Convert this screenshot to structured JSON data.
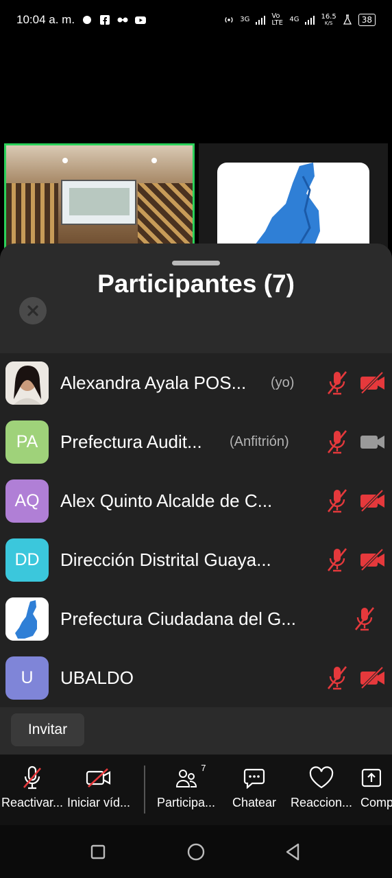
{
  "status_bar": {
    "time": "10:04 a. m.",
    "net_3g": "3G",
    "volte": "Vo LTE",
    "net_4g": "4G",
    "speed": "16.5",
    "speed_unit": "K/S",
    "battery": "38"
  },
  "sheet": {
    "title": "Participantes (7)",
    "invite_label": "Invitar"
  },
  "participants": [
    {
      "name": "Alexandra Ayala POS...",
      "tag": "(yo)",
      "avatar": "photo",
      "mic_muted": true,
      "video_off": true
    },
    {
      "name": "Prefectura Audit...",
      "tag": "(Anfitrión)",
      "initials": "PA",
      "avatar_color": "#9fd27a",
      "mic_muted": true,
      "video_off": false
    },
    {
      "name": "Alex Quinto Alcalde de C...",
      "tag": "",
      "initials": "AQ",
      "avatar_color": "#b07fd6",
      "mic_muted": true,
      "video_off": true
    },
    {
      "name": "Dirección Distrital Guaya...",
      "tag": "",
      "initials": "DD",
      "avatar_color": "#3bc7dc",
      "mic_muted": true,
      "video_off": true
    },
    {
      "name": "Prefectura Ciudadana del G...",
      "tag": "",
      "avatar": "map",
      "mic_muted": true,
      "video_off": null
    },
    {
      "name": "UBALDO",
      "tag": "",
      "initials": "U",
      "avatar_color": "#7f85d8",
      "mic_muted": true,
      "video_off": true
    }
  ],
  "toolbar": {
    "unmute_label": "Reactivar...",
    "start_video_label": "Iniciar víd...",
    "participants_label": "Participa...",
    "participants_count": "7",
    "chat_label": "Chatear",
    "reactions_label": "Reaccion...",
    "share_label": "Comp"
  },
  "colors": {
    "muted_red": "#e5393c",
    "active_speaker_border": "#2bd15a",
    "sheet_bg": "#2b2b2b"
  }
}
